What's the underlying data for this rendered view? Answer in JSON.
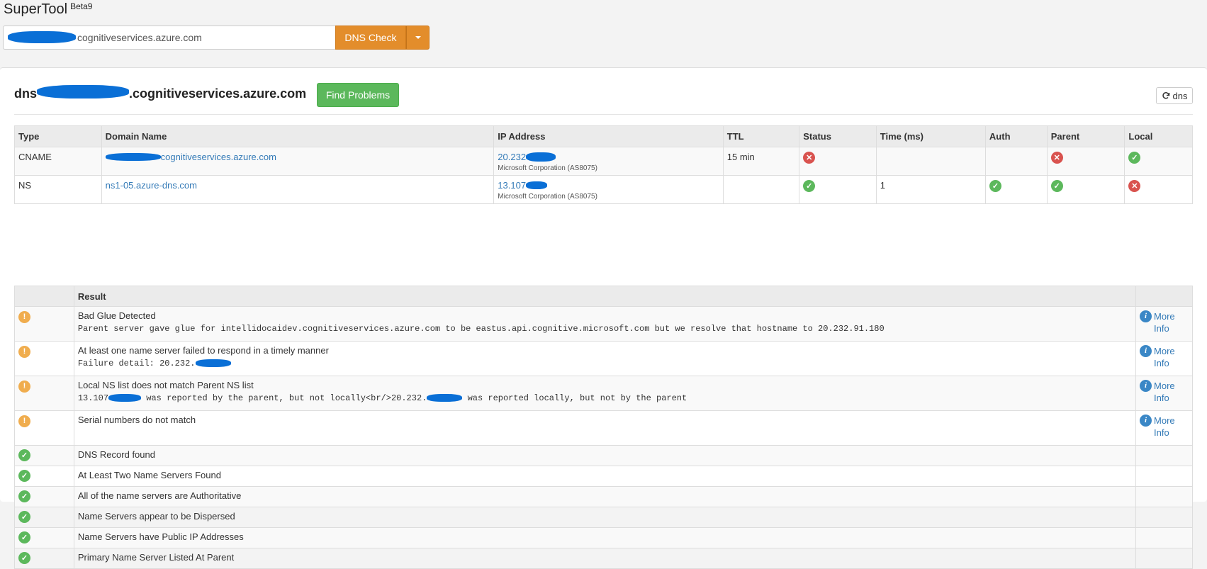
{
  "app": {
    "title": "SuperTool",
    "badge": "Beta9"
  },
  "search": {
    "value_suffix": "cognitiveservices.azure.com",
    "button_label": "DNS Check"
  },
  "panel": {
    "domain_prefix": "dns",
    "domain_suffix": ".cognitiveservices.azure.com",
    "find_button": "Find Problems",
    "refresh_label": "dns"
  },
  "records": {
    "headers": [
      "Type",
      "Domain Name",
      "IP Address",
      "TTL",
      "Status",
      "Time (ms)",
      "Auth",
      "Parent",
      "Local"
    ],
    "rows": [
      {
        "type": "CNAME",
        "domain_suffix": "cognitiveservices.azure.com",
        "ip_prefix": "20.232",
        "ip_owner": "Microsoft Corporation (AS8075)",
        "ttl": "15 min",
        "status": "bad",
        "time": "",
        "auth": "",
        "parent": "bad",
        "local": "ok"
      },
      {
        "type": "NS",
        "domain": "ns1-05.azure-dns.com",
        "ip_prefix": "13.107",
        "ip_owner": "Microsoft Corporation (AS8075)",
        "ttl": "",
        "status": "ok",
        "time": "1",
        "auth": "ok",
        "parent": "ok",
        "local": "bad"
      }
    ]
  },
  "results": {
    "header": "Result",
    "more_info": "More Info",
    "items": [
      {
        "status": "warn",
        "title": "Bad Glue Detected",
        "detail": "Parent server gave glue for intellidocaidev.cognitiveservices.azure.com to be eastus.api.cognitive.microsoft.com but we resolve that hostname to 20.232.91.180"
      },
      {
        "status": "warn",
        "title": "At least one name server failed to respond in a timely manner",
        "detail_prefix": "Failure detail: 20.232."
      },
      {
        "status": "warn",
        "title": "Local NS list does not match Parent NS list",
        "detail_a": "13.107",
        "detail_b": "was reported by the parent, but not locally<br/>20.232.",
        "detail_c": "was reported locally, but not by the parent"
      },
      {
        "status": "warn",
        "title": "Serial numbers do not match"
      },
      {
        "status": "ok",
        "title": "DNS Record found"
      },
      {
        "status": "ok",
        "title": "At Least Two Name Servers Found"
      },
      {
        "status": "ok",
        "title": "All of the name servers are Authoritative"
      },
      {
        "status": "ok",
        "title": "Name Servers appear to be Dispersed"
      },
      {
        "status": "ok",
        "title": "Name Servers have Public IP Addresses"
      },
      {
        "status": "ok",
        "title": "Primary Name Server Listed At Parent"
      }
    ]
  },
  "colors": {
    "accent_orange": "#e38d2b",
    "ok_green": "#5cb85c",
    "error_red": "#d9534f",
    "warn_orange": "#f0ad4e",
    "link_blue": "#337ab7",
    "redaction_blue": "#0a6fd6"
  }
}
